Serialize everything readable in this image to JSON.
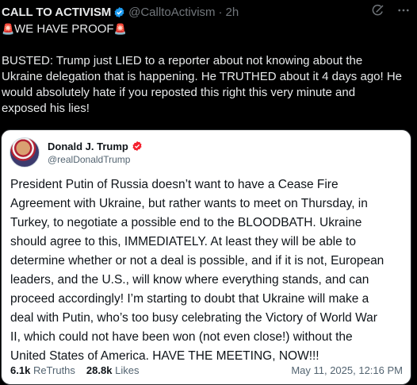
{
  "post": {
    "author_name": "CALL TO ACTIVISM",
    "author_handle": "@CalltoActivism",
    "separator": "·",
    "time": "2h",
    "headline": "WE HAVE PROOF",
    "body_lines": [
      "BUSTED: Trump just LIED to a reporter about not knowing about the",
      "Ukraine delegation that is happening. He TRUTHED about it 4 days ago! He",
      "would absolutely hate if you reposted this right this very minute and",
      "exposed his lies!"
    ]
  },
  "icons": {
    "verified": "verified-badge-icon",
    "siren": "police-siren-emoji-icon",
    "grok": "grok-icon",
    "more": "more-options-icon"
  },
  "quote": {
    "author_name": "Donald J. Trump",
    "author_handle": "@realDonaldTrump",
    "text_lines": [
      "President Putin of Russia doesn’t want to have a Cease Fire",
      "Agreement with Ukraine, but rather wants to meet on Thursday, in",
      "Turkey, to negotiate a possible end to the BLOODBATH. Ukraine",
      "should agree to this, IMMEDIATELY. At least they will be able to",
      "determine whether or not a deal is possible, and if it is not, European",
      "leaders, and the U.S., will know where everything stands, and can",
      "proceed accordingly! I’m starting to doubt that Ukraine will make a",
      "deal with Putin, who’s too busy celebrating the Victory of World War",
      "II, which could not have been won (not even close!) without the",
      "United States of America. HAVE THE MEETING, NOW!!!"
    ],
    "retruths_count": "6.1k",
    "retruths_label": "ReTruths",
    "likes_count": "28.8k",
    "likes_label": "Likes",
    "date": "May 11, 2025, 12:16 PM"
  },
  "colors": {
    "background": "#000000",
    "text": "#e7e9ea",
    "muted": "#71767b",
    "verified_blue": "#1d9bf0",
    "badge_red": "#f4212e",
    "quote_bg": "#ffffff"
  }
}
